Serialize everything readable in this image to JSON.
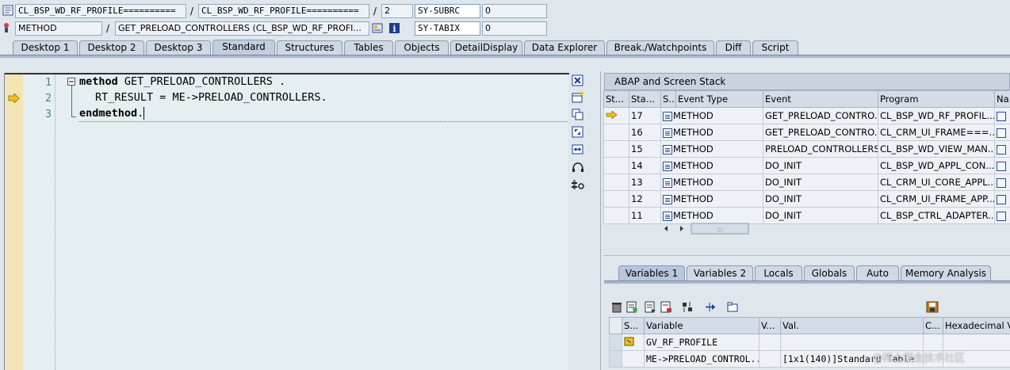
{
  "header": {
    "row1": {
      "program": "CL_BSP_WD_RF_PROFILE==========",
      "include": "CL_BSP_WD_RF_PROFILE==========",
      "line": "2",
      "sysfield_name": "SY-SUBRC",
      "sysfield_value": "0"
    },
    "row2": {
      "event_type": "METHOD",
      "event": "GET_PRELOAD_CONTROLLERS (CL_BSP_WD_RF_PROFI...",
      "sysfield_name": "SY-TABIX",
      "sysfield_value": "0"
    },
    "slash": "/"
  },
  "tabs": [
    {
      "label": "Desktop 1"
    },
    {
      "label": "Desktop 2"
    },
    {
      "label": "Desktop 3"
    },
    {
      "label": "Standard"
    },
    {
      "label": "Structures"
    },
    {
      "label": "Tables"
    },
    {
      "label": "Objects"
    },
    {
      "label": "DetailDisplay"
    },
    {
      "label": "Data Explorer"
    },
    {
      "label": "Break./Watchpoints"
    },
    {
      "label": "Diff"
    },
    {
      "label": "Script"
    }
  ],
  "active_tab": "Standard",
  "editor": {
    "lines": [
      {
        "num": "1",
        "kw": "method",
        "rest": " GET_PRELOAD_CONTROLLERS ."
      },
      {
        "num": "2",
        "kw": "",
        "rest": "RT_RESULT = ME->PRELOAD_CONTROLLERS."
      },
      {
        "num": "3",
        "kw": "endmethod",
        "rest": "."
      }
    ],
    "current_line": "2"
  },
  "stack": {
    "title": "ABAP and Screen Stack",
    "columns": [
      "St...",
      "Sta...",
      "S...",
      "Event Type",
      "Event",
      "Program",
      "Na..."
    ],
    "rows": [
      {
        "level": "17",
        "type": "METHOD",
        "event": "GET_PRELOAD_CONTRO...",
        "program": "CL_BSP_WD_RF_PROFIL...",
        "current": true
      },
      {
        "level": "16",
        "type": "METHOD",
        "event": "GET_PRELOAD_CONTRO...",
        "program": "CL_CRM_UI_FRAME===...",
        "current": false
      },
      {
        "level": "15",
        "type": "METHOD",
        "event": "PRELOAD_CONTROLLERS",
        "program": "CL_BSP_WD_VIEW_MAN...",
        "current": false
      },
      {
        "level": "14",
        "type": "METHOD",
        "event": "DO_INIT",
        "program": "CL_BSP_WD_APPL_CON...",
        "current": false
      },
      {
        "level": "13",
        "type": "METHOD",
        "event": "DO_INIT",
        "program": "CL_CRM_UI_CORE_APPL...",
        "current": false
      },
      {
        "level": "12",
        "type": "METHOD",
        "event": "DO_INIT",
        "program": "CL_CRM_UI_FRAME_APP...",
        "current": false
      },
      {
        "level": "11",
        "type": "METHOD",
        "event": "DO_INIT",
        "program": "CL_BSP_CTRL_ADAPTER...",
        "current": false
      }
    ]
  },
  "var_tabs": [
    {
      "label": "Variables 1"
    },
    {
      "label": "Variables 2"
    },
    {
      "label": "Locals"
    },
    {
      "label": "Globals"
    },
    {
      "label": "Auto"
    },
    {
      "label": "Memory Analysis"
    }
  ],
  "variables": {
    "columns": [
      "S...",
      "Variable",
      "V...",
      "Val.",
      "C...",
      "Hexadecimal Va"
    ],
    "rows": [
      {
        "variable": "GV_RF_PROFILE",
        "value": ""
      },
      {
        "variable": "ME->PRELOAD_CONTROL...",
        "value": "[1x1(140)]Standard Table"
      }
    ]
  },
  "watermark": "@稀土掘金技术社区",
  "colors": {
    "accent": "#2a4c8b",
    "marker": "#f2e4b4",
    "editor_bg": "#e5eef0"
  }
}
